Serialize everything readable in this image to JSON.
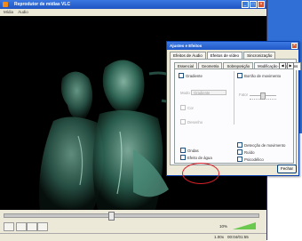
{
  "vlc": {
    "title": "Reprodutor de mídias VLC",
    "menu": [
      "Mídia",
      "Áudio"
    ],
    "status": {
      "speed": "1.00x",
      "time": "00:04/01:55"
    },
    "volume_pct": "10%",
    "seek_progress": 0.41
  },
  "dialog": {
    "title": "Ajustes e Efeitos",
    "tabs": [
      "Efeitos de Áudio",
      "Efeitos de vídeo",
      "Sincronização"
    ],
    "subtabs": [
      "Essencial",
      "Geometria",
      "Sobreposição",
      "Modificação de imagens"
    ],
    "options": {
      "gradient": "Gradiente",
      "mode_label": "Modo",
      "mode_value": "Gradiente",
      "color": "Cor",
      "cartoon": "Desenho",
      "waves": "Ondas",
      "water": "Efeito de água",
      "motion_blur": "Borrão de movimento",
      "factor_label": "Fator",
      "motion_detect": "Detecção de movimento",
      "noise": "Ruído",
      "psychedelic": "Psicodélico"
    },
    "close_button": "Fechar"
  }
}
